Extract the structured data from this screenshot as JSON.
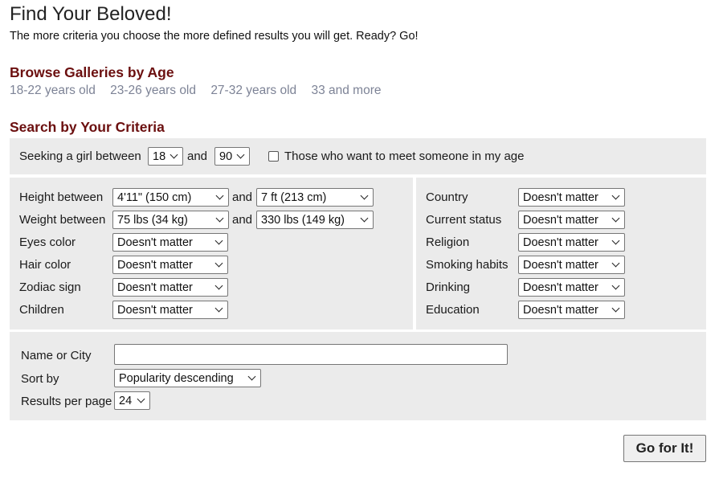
{
  "header": {
    "title": "Find Your Beloved!",
    "subtitle": "The more criteria you choose the more defined results you will get. Ready? Go!"
  },
  "browse": {
    "heading": "Browse Galleries by Age",
    "links": [
      "18-22 years old",
      "23-26 years old",
      "27-32 years old",
      "33 and more"
    ]
  },
  "criteria": {
    "heading": "Search by Your Criteria",
    "seeking": {
      "label_before": "Seeking a girl between",
      "min_age": "18",
      "label_and": "and",
      "max_age": "90",
      "checkbox_label": "Those who want to meet someone in my age"
    },
    "left": {
      "height_label": "Height between",
      "height_from": "4'11\" (150 cm)",
      "height_and": "and",
      "height_to": "7 ft (213 cm)",
      "weight_label": "Weight between",
      "weight_from": "75 lbs (34 kg)",
      "weight_and": "and",
      "weight_to": "330 lbs (149 kg)",
      "fields": [
        {
          "label": "Eyes color",
          "value": "Doesn't matter"
        },
        {
          "label": "Hair color",
          "value": "Doesn't matter"
        },
        {
          "label": "Zodiac sign",
          "value": "Doesn't matter"
        },
        {
          "label": "Children",
          "value": "Doesn't matter"
        }
      ]
    },
    "right": {
      "fields": [
        {
          "label": "Country",
          "value": "Doesn't matter"
        },
        {
          "label": "Current status",
          "value": "Doesn't matter"
        },
        {
          "label": "Religion",
          "value": "Doesn't matter"
        },
        {
          "label": "Smoking habits",
          "value": "Doesn't matter"
        },
        {
          "label": "Drinking",
          "value": "Doesn't matter"
        },
        {
          "label": "Education",
          "value": "Doesn't matter"
        }
      ]
    },
    "bottom": {
      "name_label": "Name or City",
      "name_value": "",
      "sort_label": "Sort by",
      "sort_value": "Popularity descending",
      "per_page_label": "Results per page",
      "per_page_value": "24"
    },
    "submit_label": "Go for It!"
  },
  "colors": {
    "heading": "#6b0f0f",
    "link": "#7d8396",
    "panel": "#ebebeb"
  }
}
